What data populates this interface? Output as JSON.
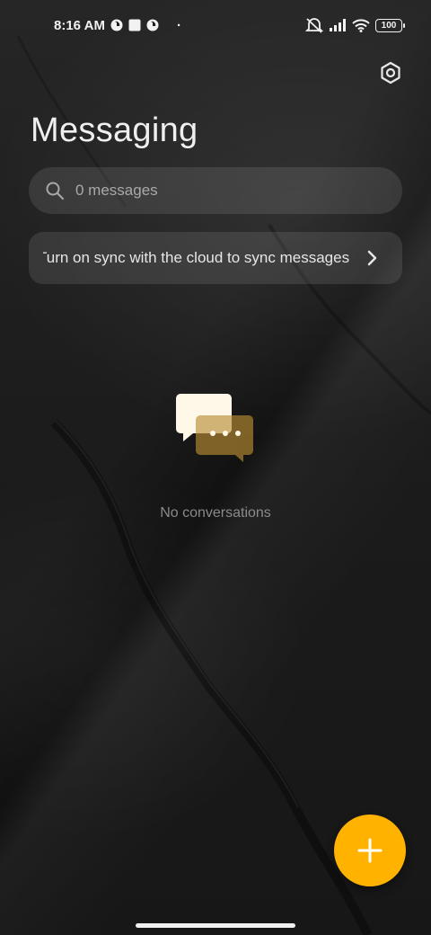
{
  "status_bar": {
    "time": "8:16 AM",
    "dot": "·",
    "battery": "100"
  },
  "header": {
    "title": "Messaging",
    "settings_icon": "settings-icon"
  },
  "search": {
    "placeholder": "0 messages"
  },
  "sync_banner": {
    "text": "Turn on sync with the cloud to sync messages"
  },
  "empty_state": {
    "label": "No conversations"
  },
  "fab": {
    "icon": "plus-icon"
  },
  "colors": {
    "accent": "#ffb300",
    "bubble_front": "#fff8e8",
    "bubble_back": "#8a6a2a"
  }
}
